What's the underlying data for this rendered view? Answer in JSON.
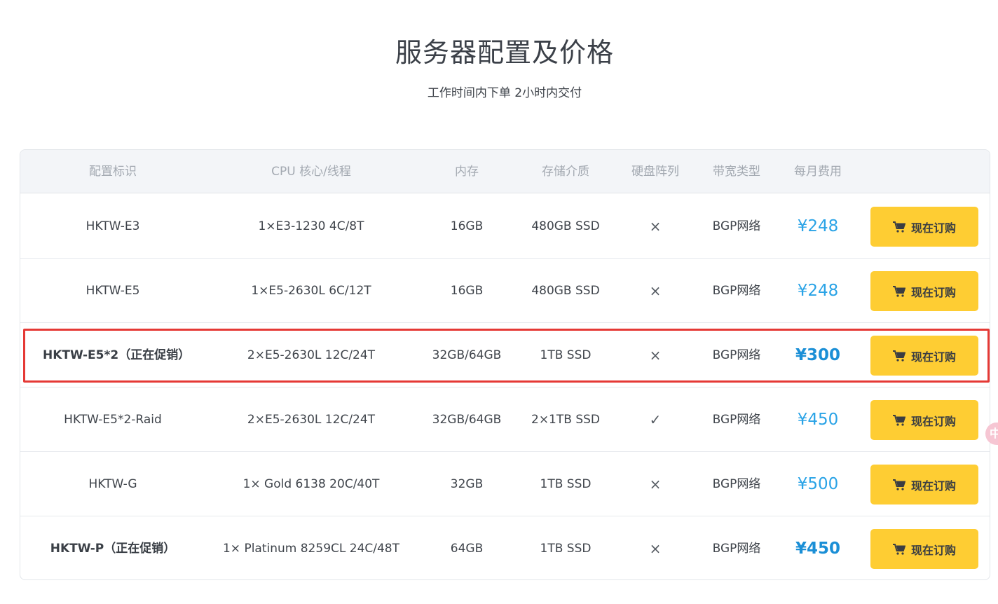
{
  "header": {
    "title": "服务器配置及价格",
    "subtitle": "工作时间内下单 2小时内交付"
  },
  "table": {
    "columns": [
      "配置标识",
      "CPU 核心/线程",
      "内存",
      "存储介质",
      "硬盘阵列",
      "带宽类型",
      "每月费用"
    ],
    "rows": [
      {
        "id": "HKTW-E3",
        "cpu": "1×E3-1230 4C/8T",
        "memory": "16GB",
        "storage": "480GB SSD",
        "raid": "×",
        "bandwidth": "BGP网络",
        "price": "¥248",
        "buy": "现在订购"
      },
      {
        "id": "HKTW-E5",
        "cpu": "1×E5-2630L 6C/12T",
        "memory": "16GB",
        "storage": "480GB SSD",
        "raid": "×",
        "bandwidth": "BGP网络",
        "price": "¥248",
        "buy": "现在订购"
      },
      {
        "id": "HKTW-E5*2（正在促销）",
        "cpu": "2×E5-2630L 12C/24T",
        "memory": "32GB/64GB",
        "storage": "1TB SSD",
        "raid": "×",
        "bandwidth": "BGP网络",
        "price": "¥300",
        "buy": "现在订购"
      },
      {
        "id": "HKTW-E5*2-Raid",
        "cpu": "2×E5-2630L 12C/24T",
        "memory": "32GB/64GB",
        "storage": "2×1TB SSD",
        "raid": "✓",
        "bandwidth": "BGP网络",
        "price": "¥450",
        "buy": "现在订购"
      },
      {
        "id": "HKTW-G",
        "cpu": "1× Gold 6138 20C/40T",
        "memory": "32GB",
        "storage": "1TB SSD",
        "raid": "×",
        "bandwidth": "BGP网络",
        "price": "¥500",
        "buy": "现在订购"
      },
      {
        "id": "HKTW-P（正在促销）",
        "cpu": "1× Platinum 8259CL 24C/48T",
        "memory": "64GB",
        "storage": "1TB SSD",
        "raid": "×",
        "bandwidth": "BGP网络",
        "price": "¥450",
        "buy": "现在订购"
      }
    ]
  },
  "floating_widget": {
    "label": "中"
  },
  "colors": {
    "button": "#fecd33",
    "price": "#2aa3e6",
    "highlight": "#e53935",
    "header_bg": "#f3f5f8"
  },
  "icons": {
    "buy": "cart-icon"
  }
}
